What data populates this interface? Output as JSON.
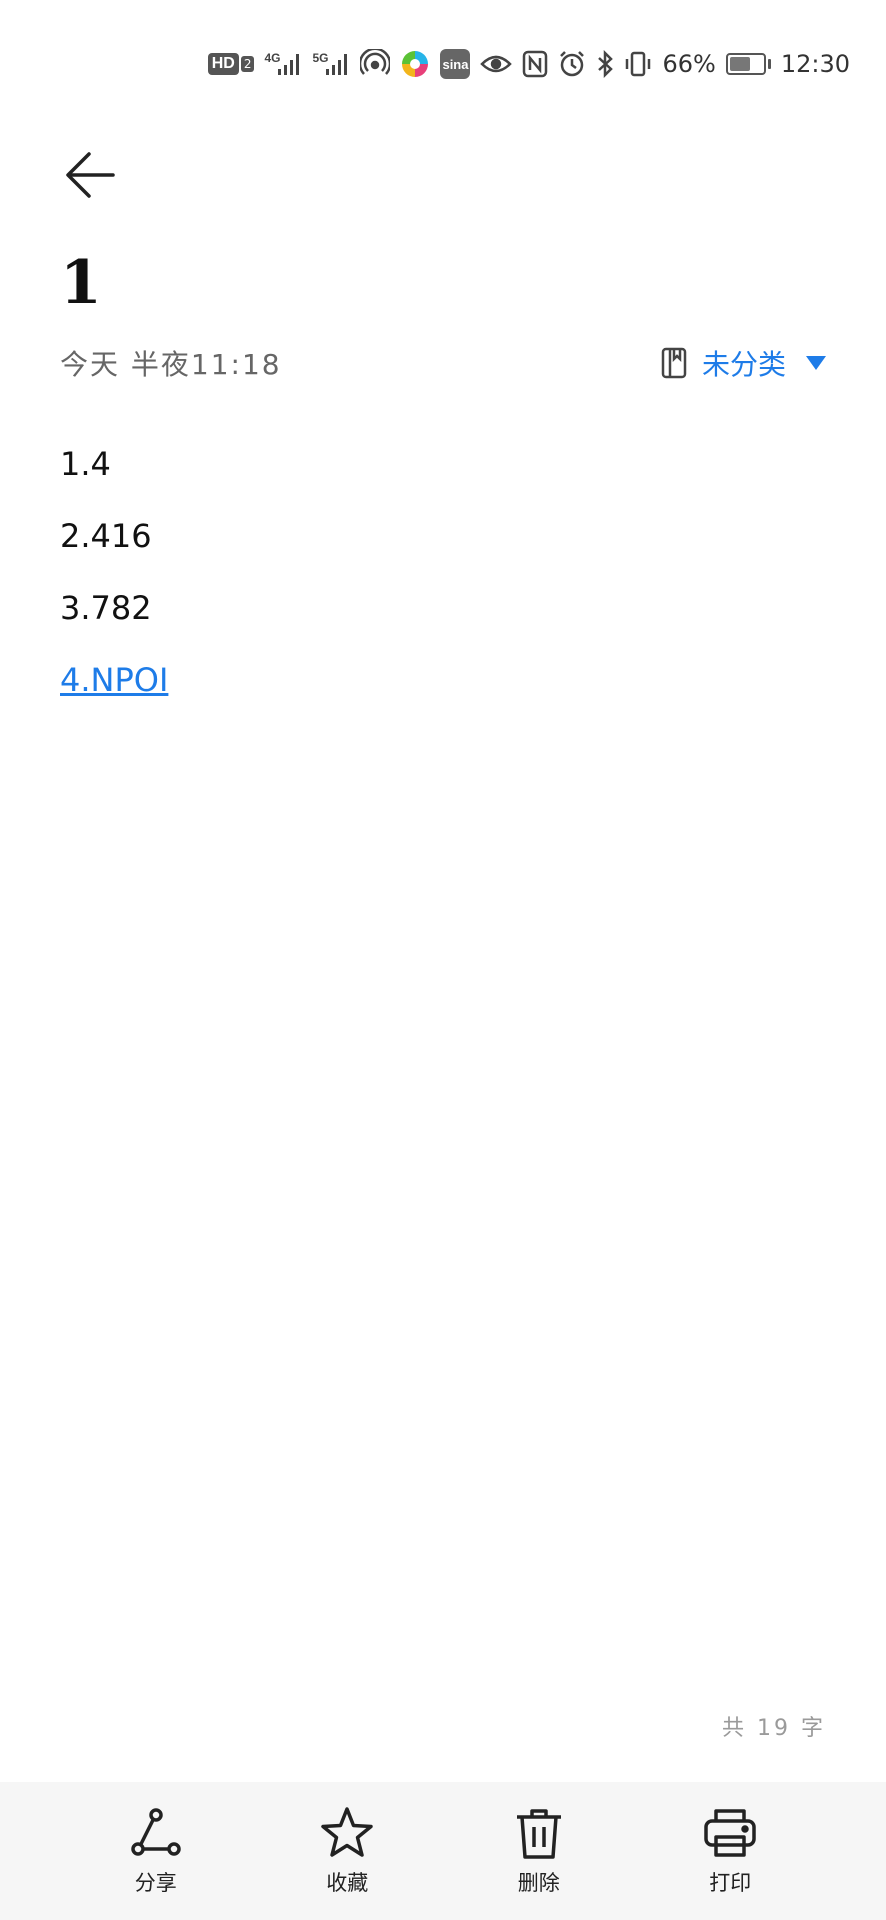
{
  "status_bar": {
    "hd_label": "HD",
    "hd_sub": "2",
    "net1": "4G",
    "net2": "5G",
    "sina": "sina",
    "battery_percent": "66%",
    "battery_level": 0.66,
    "time": "12:30",
    "icons": [
      "hd-icon",
      "signal-4g-icon",
      "signal-5g-icon",
      "hotspot-icon",
      "app-colorful-icon",
      "sina-icon",
      "eye-icon",
      "nfc-icon",
      "alarm-icon",
      "bluetooth-icon",
      "vibrate-icon",
      "battery-icon"
    ]
  },
  "header": {
    "back_icon": "arrow-left-icon"
  },
  "note": {
    "title": "1",
    "date": "今天 半夜11:18",
    "folder_label": "未分类",
    "folder_icon": "notebook-icon",
    "lines": [
      "1.4",
      "2.416",
      "3.782"
    ],
    "link_line": "4.NPOI",
    "accent_color": "#1E7CE8"
  },
  "footer": {
    "word_count": "共 19 字"
  },
  "actions": [
    {
      "label": "分享",
      "icon": "share-icon"
    },
    {
      "label": "收藏",
      "icon": "star-icon"
    },
    {
      "label": "删除",
      "icon": "trash-icon"
    },
    {
      "label": "打印",
      "icon": "printer-icon"
    }
  ]
}
